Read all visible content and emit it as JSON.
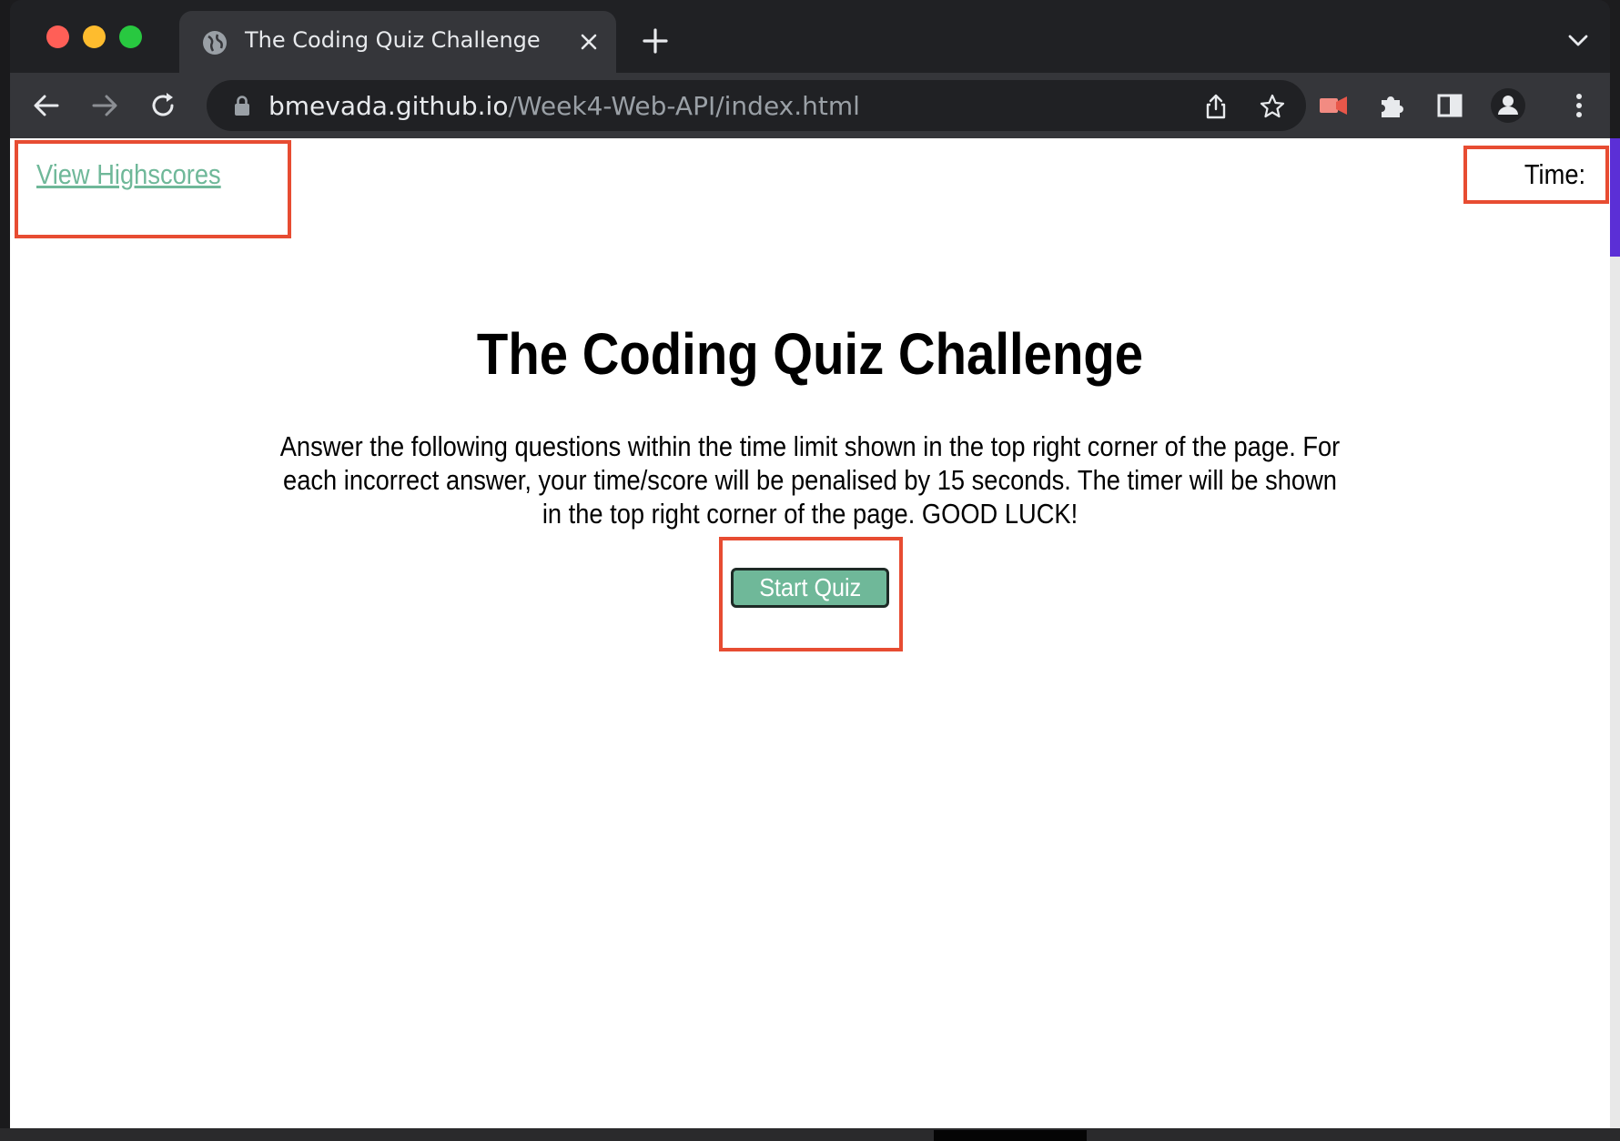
{
  "browser": {
    "tab": {
      "title": "The Coding Quiz Challenge"
    },
    "address": {
      "host": "bmevada.github.io",
      "path": "/Week4-Web-API/index.html"
    }
  },
  "page": {
    "highscores_link": "View Highscores",
    "timer": {
      "label": "Time:",
      "value": ""
    },
    "title": "The Coding Quiz Challenge",
    "intro": "Answer the following questions within the time limit shown in the top right corner of the page. For each incorrect answer, your time/score will be penalised by 15 seconds. The timer will be shown in the top right corner of the page. GOOD LUCK!",
    "start_button": "Start Quiz"
  },
  "colors": {
    "accent_green": "#6fb899",
    "annotation_red": "#e74c32",
    "chrome_dark": "#202124",
    "chrome_toolbar": "#35363a"
  }
}
